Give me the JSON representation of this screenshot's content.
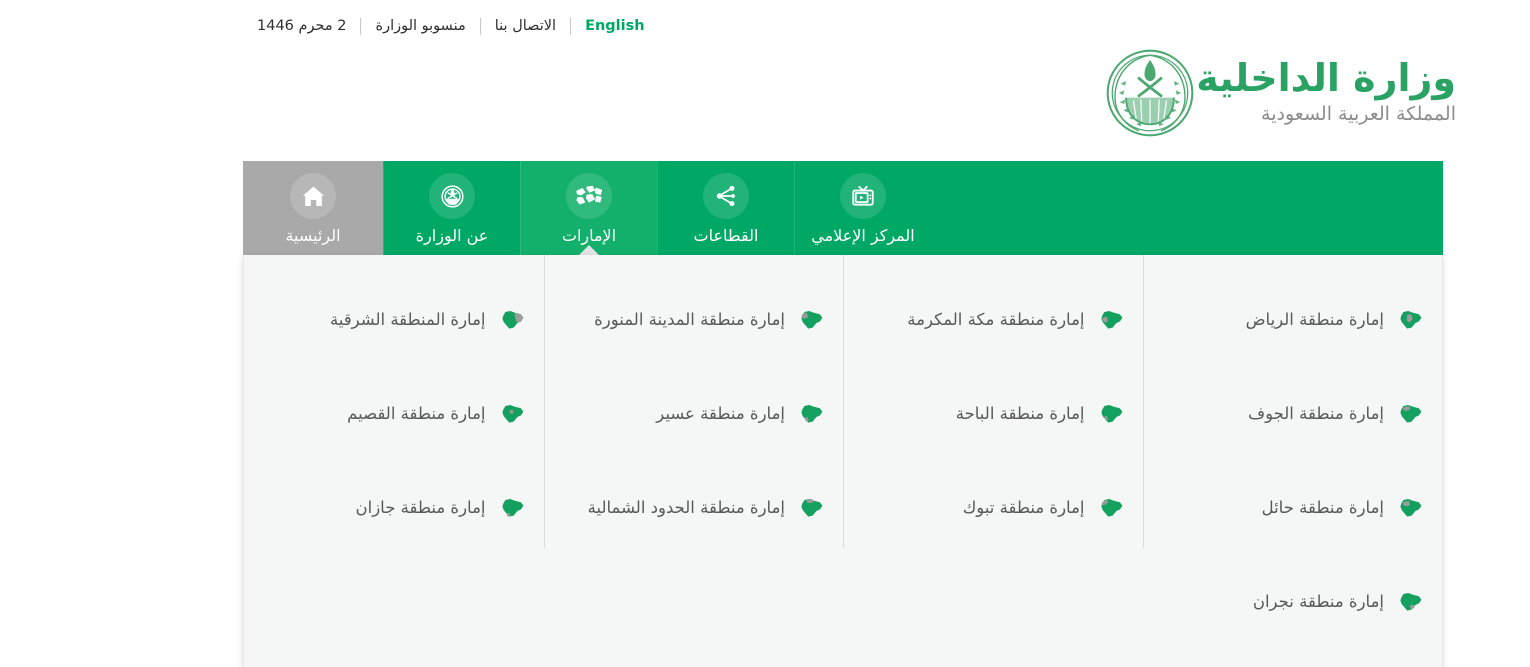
{
  "topbar": {
    "date": "2 محرم 1446",
    "staff": "منسوبو الوزارة",
    "contact": "الاتصال بنا",
    "english": "English"
  },
  "logo": {
    "title": "وزارة الداخلية",
    "subtitle": "المملكة العربية السعودية",
    "emblem_icon": "saudi-emblem-icon"
  },
  "nav": {
    "items": [
      {
        "label": "المركز الإعلامي",
        "icon": "tv-media-icon",
        "active": false,
        "home": false
      },
      {
        "label": "القطاعات",
        "icon": "share-nodes-icon",
        "active": false,
        "home": false
      },
      {
        "label": "الإمارات",
        "icon": "map-regions-icon",
        "active": true,
        "home": false
      },
      {
        "label": "عن الوزارة",
        "icon": "emblem-icon",
        "active": false,
        "home": false
      },
      {
        "label": "الرئيسية",
        "icon": "home-icon",
        "active": false,
        "home": true
      }
    ]
  },
  "panel": {
    "columns": [
      {
        "items": [
          {
            "label": "إمارة منطقة الرياض",
            "icon": "saudi-map-icon"
          },
          {
            "label": "إمارة منطقة الجوف",
            "icon": "saudi-map-icon"
          },
          {
            "label": "إمارة منطقة حائل",
            "icon": "saudi-map-icon"
          },
          {
            "label": "إمارة منطقة نجران",
            "icon": "saudi-map-icon"
          }
        ]
      },
      {
        "items": [
          {
            "label": "إمارة منطقة مكة المكرمة",
            "icon": "saudi-map-icon"
          },
          {
            "label": "إمارة منطقة الباحة",
            "icon": "saudi-map-icon"
          },
          {
            "label": "إمارة منطقة تبوك",
            "icon": "saudi-map-icon"
          }
        ]
      },
      {
        "items": [
          {
            "label": "إمارة منطقة المدينة المنورة",
            "icon": "saudi-map-icon"
          },
          {
            "label": "إمارة منطقة عسير",
            "icon": "saudi-map-icon"
          },
          {
            "label": "إمارة منطقة الحدود الشمالية",
            "icon": "saudi-map-icon"
          }
        ]
      },
      {
        "items": [
          {
            "label": "إمارة المنطقة الشرقية",
            "icon": "saudi-map-icon"
          },
          {
            "label": "إمارة منطقة القصيم",
            "icon": "saudi-map-icon"
          },
          {
            "label": "إمارة منطقة جازان",
            "icon": "saudi-map-icon"
          }
        ]
      }
    ]
  },
  "colors": {
    "brand_green": "#00a865",
    "active_green": "#13b06b",
    "home_gray": "#a9a9a9",
    "panel_bg": "#f5f6f6",
    "logo_green": "#2aa264",
    "label_gray": "#595959"
  }
}
